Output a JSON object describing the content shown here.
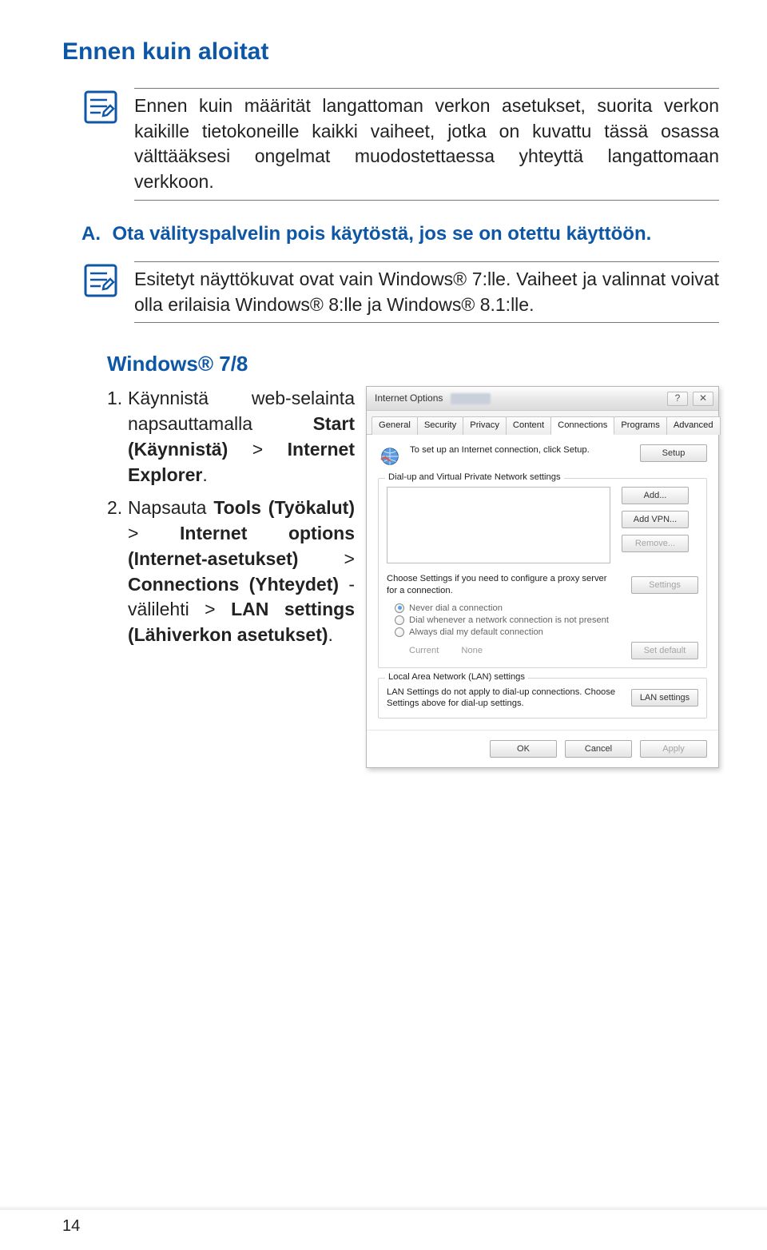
{
  "page": {
    "heading": "Ennen kuin aloitat",
    "note1": "Ennen kuin määrität langattoman verkon asetukset, suorita verkon kaikille tietokoneille kaikki vaiheet, jotka on kuvattu tässä osassa välttääksesi ongelmat muodostettaessa yhteyttä langattomaan verkkoon.",
    "section_a_label": "A.",
    "section_a_text": "Ota välityspalvelin pois käytöstä, jos se on otettu käyttöön.",
    "note2": "Esitetyt näyttökuvat ovat vain Windows® 7:lle. Vaiheet ja valinnat voivat olla erilaisia Windows® 8:lle ja Windows® 8.1:lle.",
    "sub_heading": "Windows® 7/8",
    "steps": [
      {
        "num": "1.",
        "html": "Käynnistä web-selainta napsauttamalla <b>Start (Käynnistä)</b> > <b>Internet Explorer</b>."
      },
      {
        "num": "2.",
        "html": "Napsauta <b>Tools (Työkalut)</b> > <b>Internet options (Internet-asetukset)</b> > <b>Connections (Yhteydet)</b> -välilehti > <b>LAN settings (Lähiverkon asetukset)</b>."
      }
    ],
    "page_number": "14"
  },
  "dialog": {
    "title": "Internet Options",
    "tabs": [
      "General",
      "Security",
      "Privacy",
      "Content",
      "Connections",
      "Programs",
      "Advanced"
    ],
    "active_tab": 4,
    "setup_text": "To set up an Internet connection, click Setup.",
    "btn_setup": "Setup",
    "group_dialup": "Dial-up and Virtual Private Network settings",
    "btn_add": "Add...",
    "btn_add_vpn": "Add VPN...",
    "btn_remove": "Remove...",
    "proxy_text": "Choose Settings if you need to configure a proxy server for a connection.",
    "btn_settings": "Settings",
    "radios": {
      "never": "Never dial a connection",
      "whenever": "Dial whenever a network connection is not present",
      "always": "Always dial my default connection"
    },
    "current_label": "Current",
    "current_value": "None",
    "btn_set_default": "Set default",
    "group_lan": "Local Area Network (LAN) settings",
    "lan_text": "LAN Settings do not apply to dial-up connections. Choose Settings above for dial-up settings.",
    "btn_lan": "LAN settings",
    "btn_ok": "OK",
    "btn_cancel": "Cancel",
    "btn_apply": "Apply"
  }
}
